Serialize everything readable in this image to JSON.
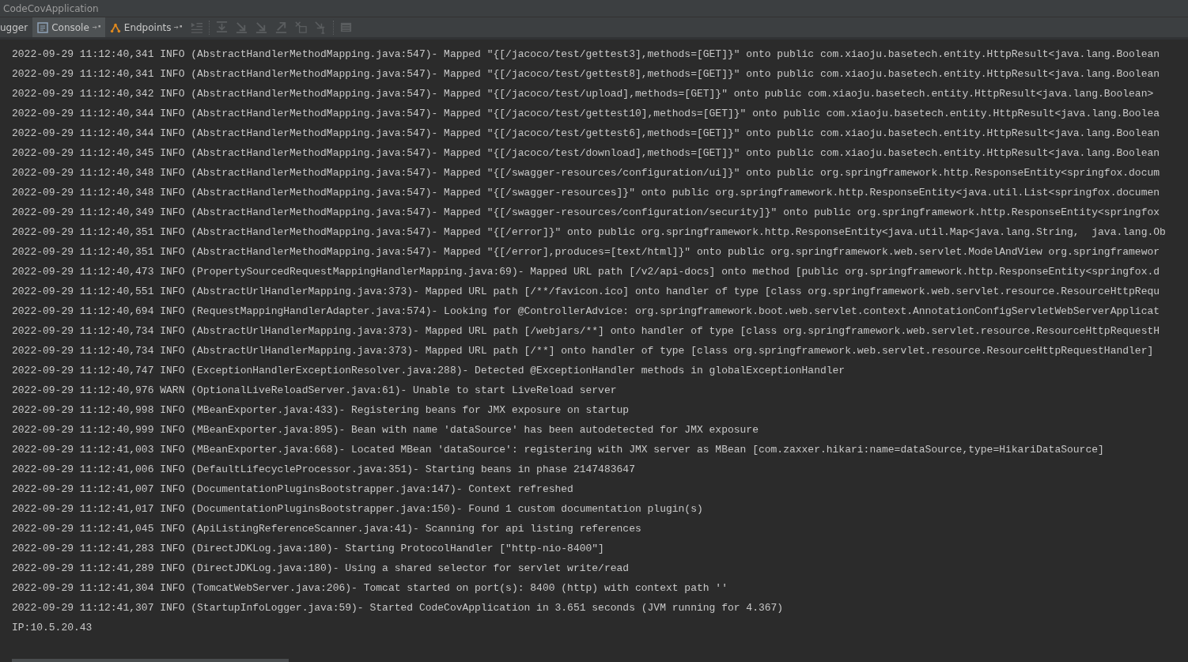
{
  "window": {
    "title": "CodeCovApplication"
  },
  "tabs": [
    {
      "label": "ugger",
      "selected": false,
      "pinned": false
    },
    {
      "label": "Console",
      "selected": true,
      "pinned": true
    },
    {
      "label": "Endpoints",
      "selected": false,
      "pinned": true
    }
  ],
  "console_lines": [
    "2022-09-29 11:12:40,341 INFO (AbstractHandlerMethodMapping.java:547)- Mapped \"{[/jacoco/test/gettest3],methods=[GET]}\" onto public com.xiaoju.basetech.entity.HttpResult<java.lang.Boolean",
    "2022-09-29 11:12:40,341 INFO (AbstractHandlerMethodMapping.java:547)- Mapped \"{[/jacoco/test/gettest8],methods=[GET]}\" onto public com.xiaoju.basetech.entity.HttpResult<java.lang.Boolean",
    "2022-09-29 11:12:40,342 INFO (AbstractHandlerMethodMapping.java:547)- Mapped \"{[/jacoco/test/upload],methods=[GET]}\" onto public com.xiaoju.basetech.entity.HttpResult<java.lang.Boolean>",
    "2022-09-29 11:12:40,344 INFO (AbstractHandlerMethodMapping.java:547)- Mapped \"{[/jacoco/test/gettest10],methods=[GET]}\" onto public com.xiaoju.basetech.entity.HttpResult<java.lang.Boolea",
    "2022-09-29 11:12:40,344 INFO (AbstractHandlerMethodMapping.java:547)- Mapped \"{[/jacoco/test/gettest6],methods=[GET]}\" onto public com.xiaoju.basetech.entity.HttpResult<java.lang.Boolean",
    "2022-09-29 11:12:40,345 INFO (AbstractHandlerMethodMapping.java:547)- Mapped \"{[/jacoco/test/download],methods=[GET]}\" onto public com.xiaoju.basetech.entity.HttpResult<java.lang.Boolean",
    "2022-09-29 11:12:40,348 INFO (AbstractHandlerMethodMapping.java:547)- Mapped \"{[/swagger-resources/configuration/ui]}\" onto public org.springframework.http.ResponseEntity<springfox.docum",
    "2022-09-29 11:12:40,348 INFO (AbstractHandlerMethodMapping.java:547)- Mapped \"{[/swagger-resources]}\" onto public org.springframework.http.ResponseEntity<java.util.List<springfox.documen",
    "2022-09-29 11:12:40,349 INFO (AbstractHandlerMethodMapping.java:547)- Mapped \"{[/swagger-resources/configuration/security]}\" onto public org.springframework.http.ResponseEntity<springfox",
    "2022-09-29 11:12:40,351 INFO (AbstractHandlerMethodMapping.java:547)- Mapped \"{[/error]}\" onto public org.springframework.http.ResponseEntity<java.util.Map<java.lang.String,  java.lang.Ob",
    "2022-09-29 11:12:40,351 INFO (AbstractHandlerMethodMapping.java:547)- Mapped \"{[/error],produces=[text/html]}\" onto public org.springframework.web.servlet.ModelAndView org.springframewor",
    "2022-09-29 11:12:40,473 INFO (PropertySourcedRequestMappingHandlerMapping.java:69)- Mapped URL path [/v2/api-docs] onto method [public org.springframework.http.ResponseEntity<springfox.d",
    "2022-09-29 11:12:40,551 INFO (AbstractUrlHandlerMapping.java:373)- Mapped URL path [/**/favicon.ico] onto handler of type [class org.springframework.web.servlet.resource.ResourceHttpRequ",
    "2022-09-29 11:12:40,694 INFO (RequestMappingHandlerAdapter.java:574)- Looking for @ControllerAdvice: org.springframework.boot.web.servlet.context.AnnotationConfigServletWebServerApplicat",
    "2022-09-29 11:12:40,734 INFO (AbstractUrlHandlerMapping.java:373)- Mapped URL path [/webjars/**] onto handler of type [class org.springframework.web.servlet.resource.ResourceHttpRequestH",
    "2022-09-29 11:12:40,734 INFO (AbstractUrlHandlerMapping.java:373)- Mapped URL path [/**] onto handler of type [class org.springframework.web.servlet.resource.ResourceHttpRequestHandler]",
    "2022-09-29 11:12:40,747 INFO (ExceptionHandlerExceptionResolver.java:288)- Detected @ExceptionHandler methods in globalExceptionHandler",
    "2022-09-29 11:12:40,976 WARN (OptionalLiveReloadServer.java:61)- Unable to start LiveReload server",
    "2022-09-29 11:12:40,998 INFO (MBeanExporter.java:433)- Registering beans for JMX exposure on startup",
    "2022-09-29 11:12:40,999 INFO (MBeanExporter.java:895)- Bean with name 'dataSource' has been autodetected for JMX exposure",
    "2022-09-29 11:12:41,003 INFO (MBeanExporter.java:668)- Located MBean 'dataSource': registering with JMX server as MBean [com.zaxxer.hikari:name=dataSource,type=HikariDataSource]",
    "2022-09-29 11:12:41,006 INFO (DefaultLifecycleProcessor.java:351)- Starting beans in phase 2147483647",
    "2022-09-29 11:12:41,007 INFO (DocumentationPluginsBootstrapper.java:147)- Context refreshed",
    "2022-09-29 11:12:41,017 INFO (DocumentationPluginsBootstrapper.java:150)- Found 1 custom documentation plugin(s)",
    "2022-09-29 11:12:41,045 INFO (ApiListingReferenceScanner.java:41)- Scanning for api listing references",
    "2022-09-29 11:12:41,283 INFO (DirectJDKLog.java:180)- Starting ProtocolHandler [\"http-nio-8400\"]",
    "2022-09-29 11:12:41,289 INFO (DirectJDKLog.java:180)- Using a shared selector for servlet write/read",
    "2022-09-29 11:12:41,304 INFO (TomcatWebServer.java:206)- Tomcat started on port(s): 8400 (http) with context path ''",
    "2022-09-29 11:12:41,307 INFO (StartupInfoLogger.java:59)- Started CodeCovApplication in 3.651 seconds (JVM running for 4.367)",
    "IP:10.5.20.43"
  ]
}
